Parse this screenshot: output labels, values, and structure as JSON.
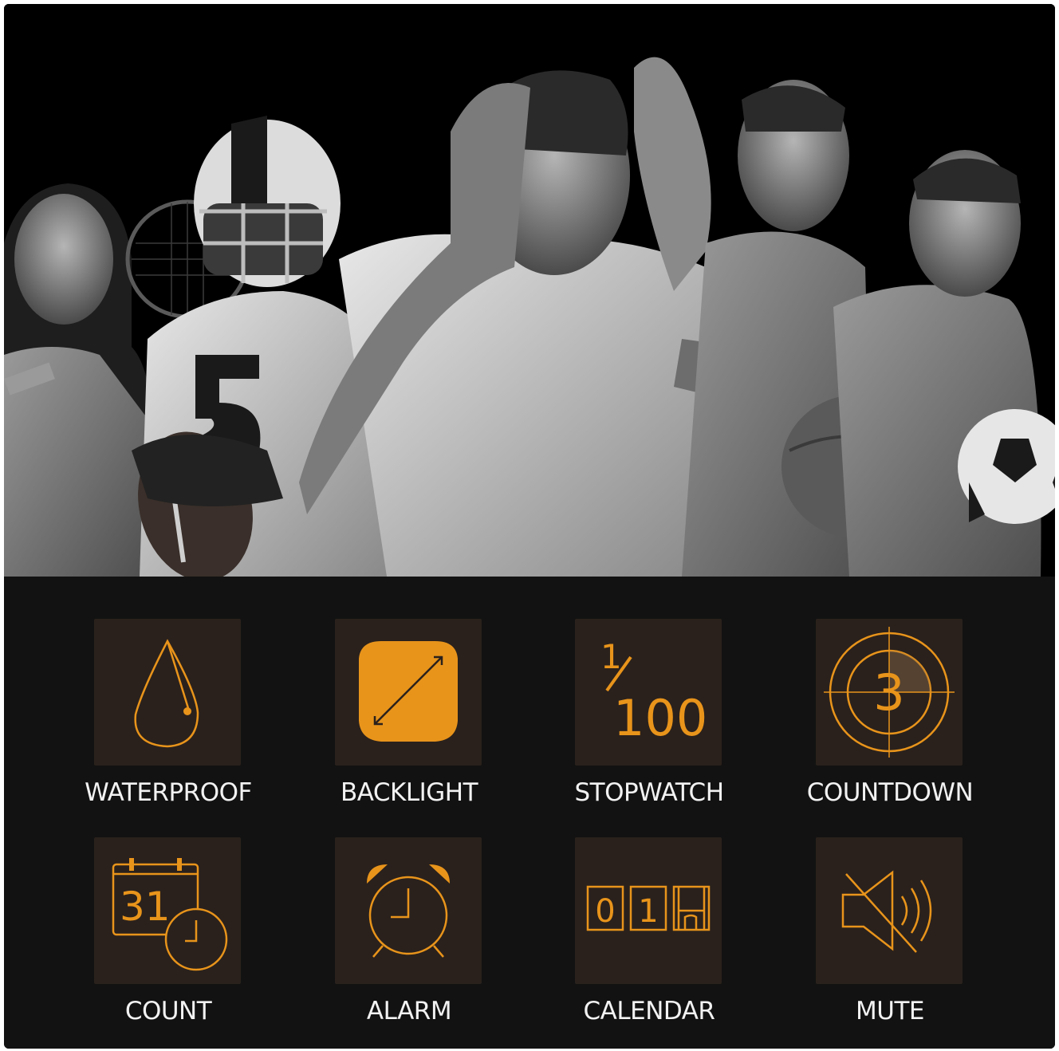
{
  "hero": {
    "image": "athletes-group-photo",
    "jersey_number": "5"
  },
  "features": [
    {
      "label": "WATERPROOF",
      "icon": "water-drop-icon"
    },
    {
      "label": "BACKLIGHT",
      "icon": "backlight-screen-icon"
    },
    {
      "label": "STOPWATCH",
      "icon": "hundredth-second-icon",
      "glyph_top": "1",
      "glyph_main": "100"
    },
    {
      "label": "COUNTDOWN",
      "icon": "countdown-target-icon",
      "glyph_main": "3"
    },
    {
      "label": "COUNT",
      "icon": "calendar-clock-icon",
      "glyph_main": "31"
    },
    {
      "label": "ALARM",
      "icon": "alarm-clock-icon"
    },
    {
      "label": "CALENDAR",
      "icon": "date-flip-icon",
      "digits": [
        "0",
        "1"
      ]
    },
    {
      "label": "MUTE",
      "icon": "speaker-mute-icon"
    }
  ],
  "colors": {
    "accent": "#e8941b",
    "tile": "#2a211c",
    "panel": "#121212",
    "text": "#f2f2f2"
  }
}
